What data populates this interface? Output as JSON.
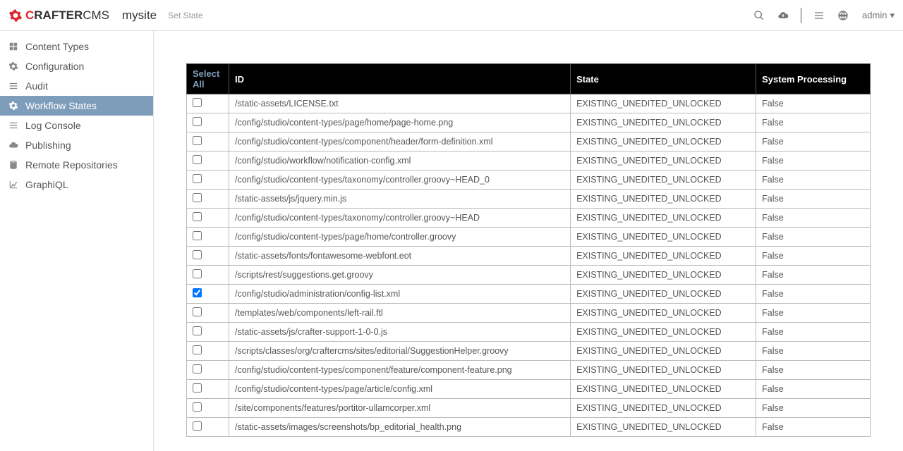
{
  "brand": {
    "red": "C",
    "rest": "RAFTER",
    "cms": "CMS"
  },
  "site_name": "mysite",
  "breadcrumb": "Set State",
  "user": {
    "name": "admin"
  },
  "sidebar": [
    {
      "key": "content-types",
      "label": "Content Types",
      "icon": "grid"
    },
    {
      "key": "configuration",
      "label": "Configuration",
      "icon": "gear"
    },
    {
      "key": "audit",
      "label": "Audit",
      "icon": "list"
    },
    {
      "key": "workflow-states",
      "label": "Workflow States",
      "icon": "gear",
      "active": true
    },
    {
      "key": "log-console",
      "label": "Log Console",
      "icon": "list"
    },
    {
      "key": "publishing",
      "label": "Publishing",
      "icon": "cloud"
    },
    {
      "key": "remote-repositories",
      "label": "Remote Repositories",
      "icon": "db"
    },
    {
      "key": "graphiql",
      "label": "GraphiQL",
      "icon": "chart"
    }
  ],
  "table": {
    "headers": {
      "select_all": "Select All",
      "id": "ID",
      "state": "State",
      "system_processing": "System Processing"
    },
    "rows": [
      {
        "id": "/static-assets/LICENSE.txt",
        "state": "EXISTING_UNEDITED_UNLOCKED",
        "sp": "False",
        "checked": false
      },
      {
        "id": "/config/studio/content-types/page/home/page-home.png",
        "state": "EXISTING_UNEDITED_UNLOCKED",
        "sp": "False",
        "checked": false
      },
      {
        "id": "/config/studio/content-types/component/header/form-definition.xml",
        "state": "EXISTING_UNEDITED_UNLOCKED",
        "sp": "False",
        "checked": false
      },
      {
        "id": "/config/studio/workflow/notification-config.xml",
        "state": "EXISTING_UNEDITED_UNLOCKED",
        "sp": "False",
        "checked": false
      },
      {
        "id": "/config/studio/content-types/taxonomy/controller.groovy~HEAD_0",
        "state": "EXISTING_UNEDITED_UNLOCKED",
        "sp": "False",
        "checked": false
      },
      {
        "id": "/static-assets/js/jquery.min.js",
        "state": "EXISTING_UNEDITED_UNLOCKED",
        "sp": "False",
        "checked": false
      },
      {
        "id": "/config/studio/content-types/taxonomy/controller.groovy~HEAD",
        "state": "EXISTING_UNEDITED_UNLOCKED",
        "sp": "False",
        "checked": false
      },
      {
        "id": "/config/studio/content-types/page/home/controller.groovy",
        "state": "EXISTING_UNEDITED_UNLOCKED",
        "sp": "False",
        "checked": false
      },
      {
        "id": "/static-assets/fonts/fontawesome-webfont.eot",
        "state": "EXISTING_UNEDITED_UNLOCKED",
        "sp": "False",
        "checked": false
      },
      {
        "id": "/scripts/rest/suggestions.get.groovy",
        "state": "EXISTING_UNEDITED_UNLOCKED",
        "sp": "False",
        "checked": false
      },
      {
        "id": "/config/studio/administration/config-list.xml",
        "state": "EXISTING_UNEDITED_UNLOCKED",
        "sp": "False",
        "checked": true
      },
      {
        "id": "/templates/web/components/left-rail.ftl",
        "state": "EXISTING_UNEDITED_UNLOCKED",
        "sp": "False",
        "checked": false
      },
      {
        "id": "/static-assets/js/crafter-support-1-0-0.js",
        "state": "EXISTING_UNEDITED_UNLOCKED",
        "sp": "False",
        "checked": false
      },
      {
        "id": "/scripts/classes/org/craftercms/sites/editorial/SuggestionHelper.groovy",
        "state": "EXISTING_UNEDITED_UNLOCKED",
        "sp": "False",
        "checked": false
      },
      {
        "id": "/config/studio/content-types/component/feature/component-feature.png",
        "state": "EXISTING_UNEDITED_UNLOCKED",
        "sp": "False",
        "checked": false
      },
      {
        "id": "/config/studio/content-types/page/article/config.xml",
        "state": "EXISTING_UNEDITED_UNLOCKED",
        "sp": "False",
        "checked": false
      },
      {
        "id": "/site/components/features/portitor-ullamcorper.xml",
        "state": "EXISTING_UNEDITED_UNLOCKED",
        "sp": "False",
        "checked": false
      },
      {
        "id": "/static-assets/images/screenshots/bp_editorial_health.png",
        "state": "EXISTING_UNEDITED_UNLOCKED",
        "sp": "False",
        "checked": false
      }
    ]
  }
}
